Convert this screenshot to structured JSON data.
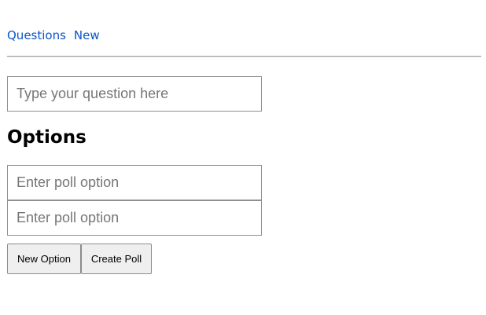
{
  "nav": {
    "questions_link": "Questions",
    "new_link": "New"
  },
  "question": {
    "value": "",
    "placeholder": "Type your question here"
  },
  "options": {
    "title": "Options",
    "fields": [
      {
        "value": "",
        "placeholder": "Enter poll option"
      },
      {
        "value": "",
        "placeholder": "Enter poll option"
      }
    ]
  },
  "actions": {
    "new_option_label": "New Option",
    "create_poll_label": "Create Poll"
  },
  "colors": {
    "link": "#0a55c8",
    "button_bg": "#efefef",
    "border": "#8f8f8f"
  }
}
